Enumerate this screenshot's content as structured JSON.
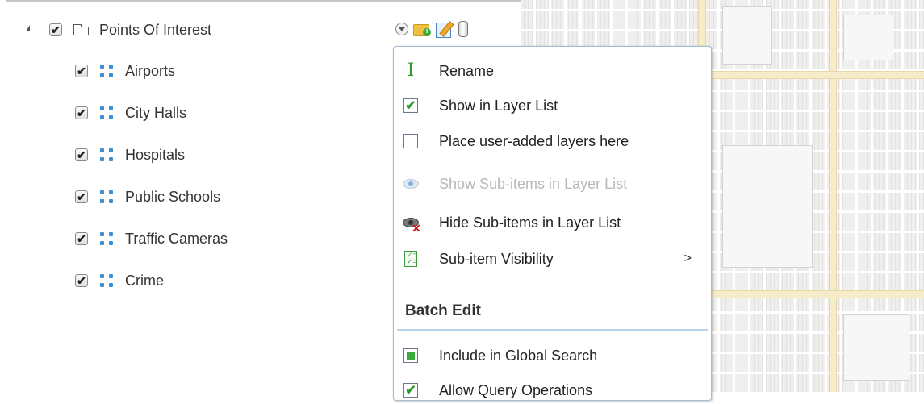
{
  "tree": {
    "root": {
      "label": "Points Of Interest",
      "checked": true,
      "icon": "folder-icon"
    },
    "children": [
      {
        "label": "Airports",
        "checked": true,
        "icon": "feature-layer-icon"
      },
      {
        "label": "City Halls",
        "checked": true,
        "icon": "feature-layer-icon"
      },
      {
        "label": "Hospitals",
        "checked": true,
        "icon": "feature-layer-icon"
      },
      {
        "label": "Public Schools",
        "checked": true,
        "icon": "feature-layer-icon"
      },
      {
        "label": "Traffic Cameras",
        "checked": true,
        "icon": "feature-layer-icon"
      },
      {
        "label": "Crime",
        "checked": true,
        "icon": "feature-layer-icon"
      }
    ]
  },
  "toolbar": {
    "icons": [
      "options-dropdown-icon",
      "add-folder-icon",
      "edit-icon",
      "database-icon"
    ]
  },
  "menu": {
    "items": [
      {
        "label": "Rename",
        "icon": "rename-cursor-icon",
        "enabled": true
      },
      {
        "label": "Show in Layer List",
        "icon": "checkbox-checked",
        "enabled": true
      },
      {
        "label": "Place user-added layers here",
        "icon": "checkbox-unchecked",
        "enabled": true
      },
      {
        "label": "Show Sub-items in Layer List",
        "icon": "eye-icon",
        "enabled": false
      },
      {
        "label": "Hide Sub-items in Layer List",
        "icon": "eye-hide-icon",
        "enabled": true
      },
      {
        "label": "Sub-item Visibility",
        "icon": "checklist-icon",
        "enabled": true,
        "submenu": ">"
      }
    ],
    "section_heading": "Batch Edit",
    "batch_items": [
      {
        "label": "Include in Global Search",
        "icon": "checkbox-partial"
      },
      {
        "label": "Allow Query Operations",
        "icon": "checkbox-checked"
      }
    ]
  },
  "colors": {
    "accent_green": "#3cab3c",
    "menu_border": "#9fbfd9",
    "map_background": "#efefee",
    "map_road": "#f6ecc9"
  }
}
